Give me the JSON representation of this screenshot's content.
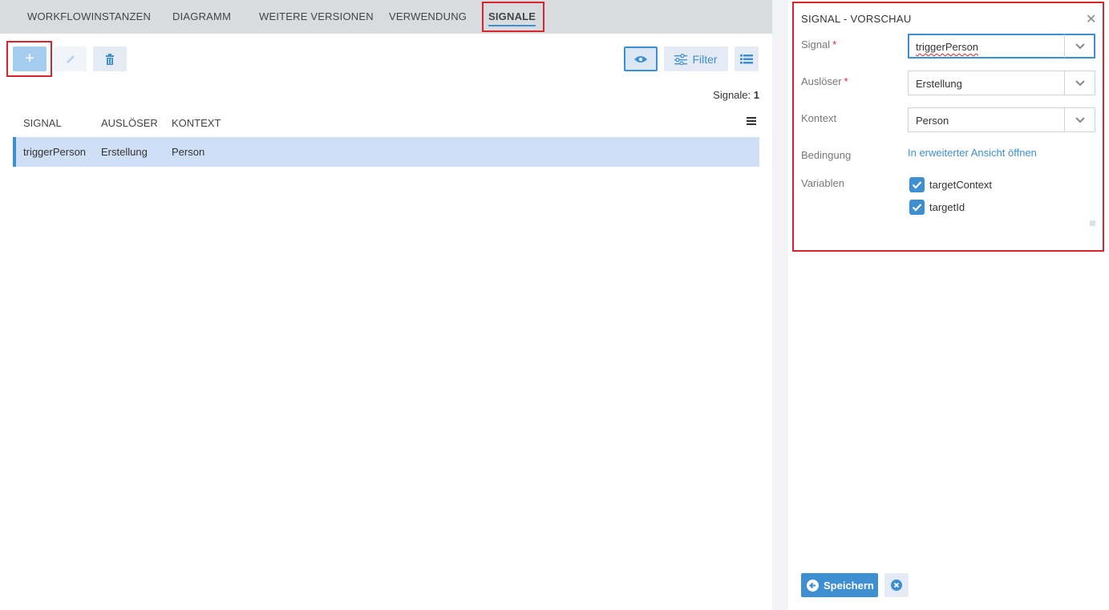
{
  "tabs": [
    {
      "label": "WORKFLOWINSTANZEN"
    },
    {
      "label": "DIAGRAMM"
    },
    {
      "label": "WEITERE VERSIONEN"
    },
    {
      "label": "VERWENDUNG"
    },
    {
      "label": "SIGNALE",
      "active": true
    }
  ],
  "toolbar": {
    "add_label": "+",
    "filter_label": "Filter",
    "count_label": "Signale:",
    "count_value": "1"
  },
  "table": {
    "columns": [
      "SIGNAL",
      "AUSLÖSER",
      "KONTEXT"
    ],
    "rows": [
      [
        "triggerPerson",
        "Erstellung",
        "Person"
      ]
    ]
  },
  "panel": {
    "title": "SIGNAL - VORSCHAU",
    "close": "✕",
    "fields": {
      "signal_label": "Signal",
      "signal_value": "triggerPerson",
      "ausloeser_label": "Auslöser",
      "ausloeser_value": "Erstellung",
      "kontext_label": "Kontext",
      "kontext_value": "Person",
      "bedingung_label": "Bedingung",
      "bedingung_link": "In erweiterter Ansicht öffnen",
      "variablen_label": "Variablen",
      "variables": [
        "targetContext",
        "targetId"
      ]
    },
    "required_mark": "*",
    "save_label": "Speichern"
  },
  "colors": {
    "accent": "#3d8fd1",
    "highlight": "#d9232d",
    "tabbar": "#d9dcdf",
    "selected_row": "#cfdff6"
  }
}
